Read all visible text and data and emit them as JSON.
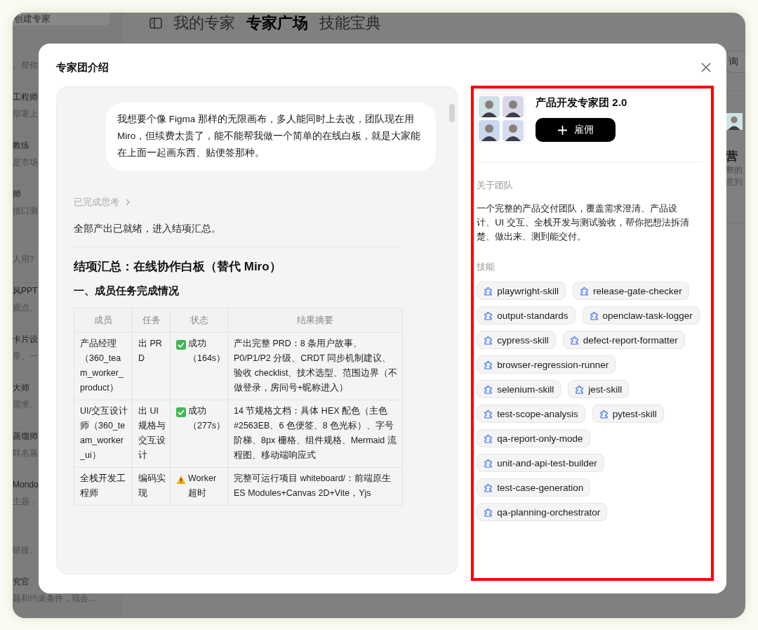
{
  "app": {
    "new_expert_button": "创建专家",
    "sidebar": {
      "items": [
        {
          "subtitle": "、帮你"
        },
        {
          "title": "工程师",
          "subtitle": "部署上"
        },
        {
          "title": "教练",
          "subtitle": "是市场"
        },
        {
          "title": "师",
          "subtitle": "接口测"
        },
        {
          "subtitle": "人用?"
        },
        {
          "title": "风PPT",
          "subtitle": "观点、"
        },
        {
          "title": "卡片设",
          "subtitle": "章、一"
        },
        {
          "title": "大师",
          "subtitle": "需求、"
        },
        {
          "title": "蒸馏师",
          "subtitle": "联名蒸"
        },
        {
          "title": "Mondo",
          "subtitle": "主题，"
        },
        {
          "subtitle": "链接、"
        },
        {
          "title": "究官",
          "subtitle": "题和约束条件，我会..."
        }
      ]
    },
    "tabs": [
      {
        "label": "我的专家",
        "selected": false
      },
      {
        "label": "专家广场",
        "selected": true
      },
      {
        "label": "技能宝典",
        "selected": false
      }
    ],
    "ask_button": "询",
    "card": {
      "title": "营",
      "description": [
        "整的",
        "意到"
      ]
    }
  },
  "dialog": {
    "title": "专家团介绍",
    "chat": {
      "user_message": "我想要个像 Figma 那样的无限画布，多人能同时上去改，团队现在用 Miro，但续费太贵了，能不能帮我做一个简单的在线白板，就是大家能在上面一起画东西、贴便签那种。",
      "thinking": "已完成思考",
      "status_line": "全部产出已就绪，进入结项汇总。",
      "heading": "结项汇总：在线协作白板（替代 Miro）",
      "subheading": "一、成员任务完成情况",
      "table": {
        "columns": [
          "成员",
          "任务",
          "状态",
          "结果摘要"
        ],
        "rows": [
          {
            "member": "产品经理（360_team_worker_product）",
            "task": "出 PRD",
            "status": {
              "kind": "success",
              "text": "成功（164s）"
            },
            "summary": "产出完整 PRD：8 条用户故事、P0/P1/P2 分级、CRDT 同步机制建议、验收 checklist、技术选型、范围边界（不做登录，房间号+昵称进入）"
          },
          {
            "member": "UI/交互设计师（360_team_worker_ui）",
            "task": "出 UI 规格与交互设计",
            "status": {
              "kind": "success",
              "text": "成功（277s）"
            },
            "summary": "14 节规格文档：具体 HEX 配色（主色 #2563EB、6 色便签、8 色光标）、字号阶梯、8px 栅格、组件规格、Mermaid 流程图、移动端响应式"
          },
          {
            "member": "全栈开发工程师",
            "task": "编码实现",
            "status": {
              "kind": "warning",
              "text": "Worker 超时"
            },
            "summary": "完整可运行项目 whiteboard/：前端原生 ES Modules+Canvas 2D+Vite，Yjs"
          }
        ]
      }
    },
    "team": {
      "name": "产品开发专家团 2.0",
      "hire_button": "雇佣",
      "about_label": "关于团队",
      "about": "一个完整的产品交付团队，覆盖需求澄清、产品设计、UI 交互、全栈开发与测试验收，帮你把想法拆清楚、做出来、测到能交付。",
      "skills_label": "技能",
      "skills": [
        "playwright-skill",
        "release-gate-checker",
        "output-standards",
        "openclaw-task-logger",
        "cypress-skill",
        "defect-report-formatter",
        "browser-regression-runner",
        "selenium-skill",
        "jest-skill",
        "test-scope-analysis",
        "pytest-skill",
        "qa-report-only-mode",
        "unit-and-api-test-builder",
        "test-case-generation",
        "qa-planning-orchestrator"
      ]
    }
  }
}
